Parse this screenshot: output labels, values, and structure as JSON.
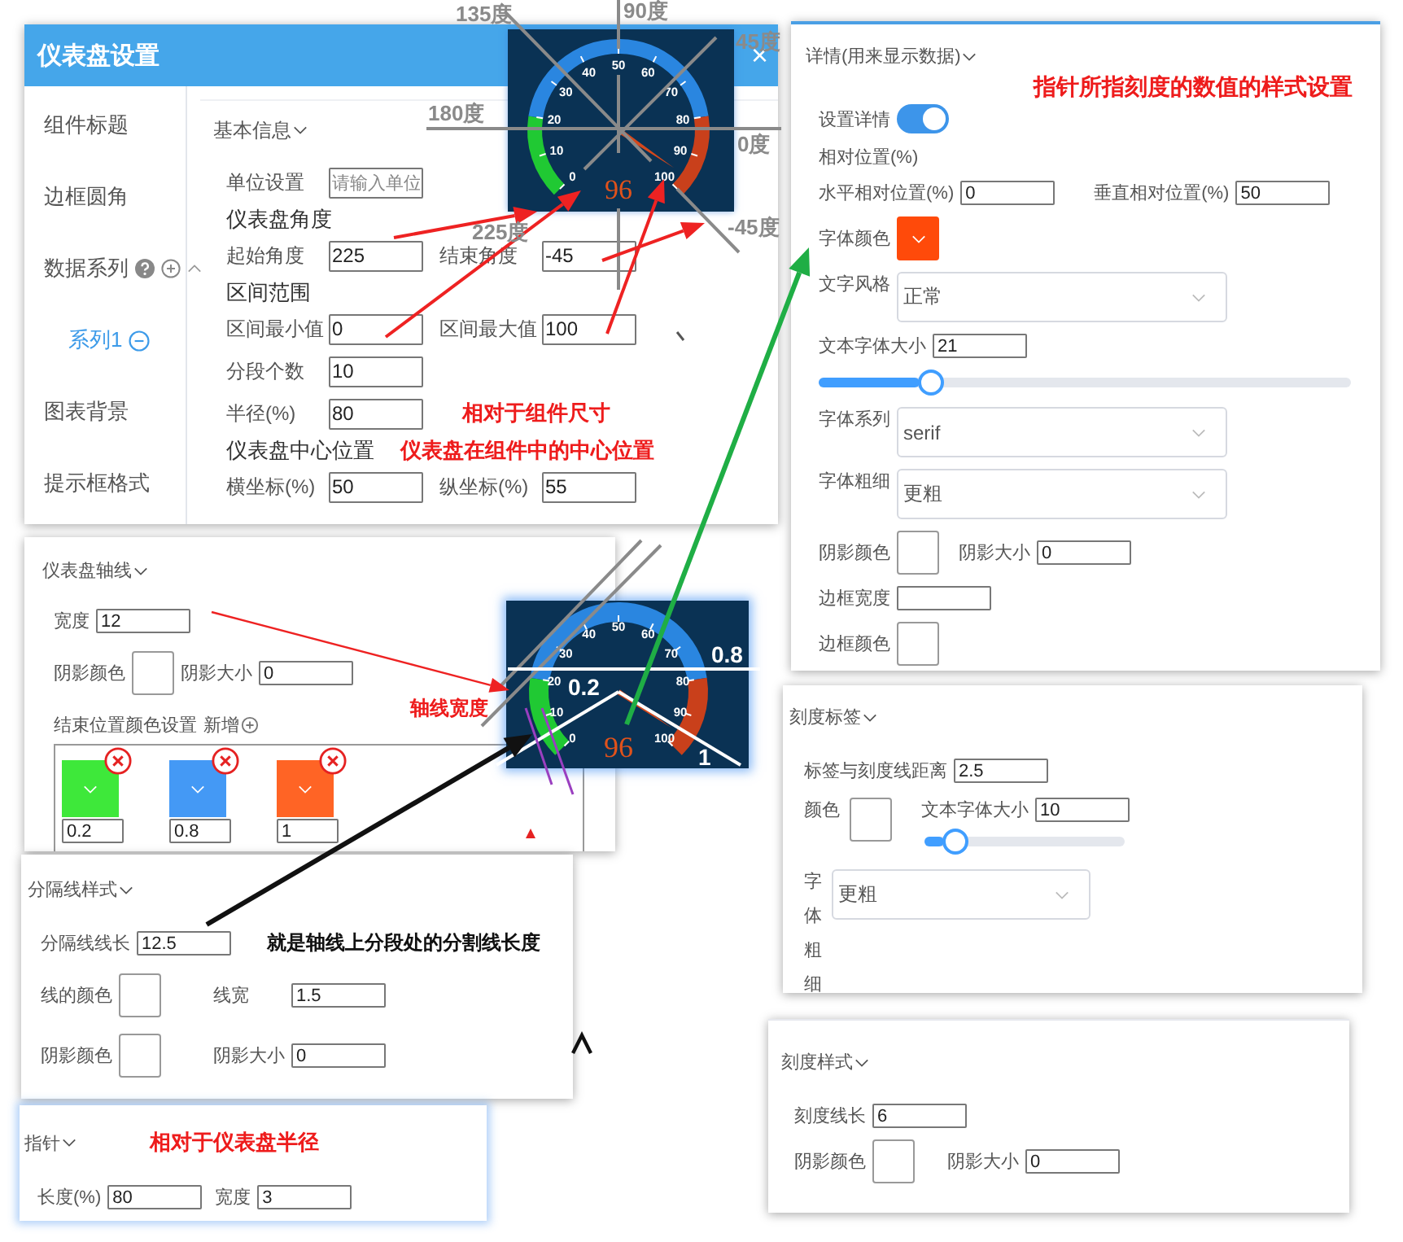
{
  "dialog": {
    "title": "仪表盘设置",
    "close": "×",
    "sidebar": [
      {
        "kind": "item",
        "label": "组件标题"
      },
      {
        "kind": "item",
        "label": "边框圆角"
      },
      {
        "kind": "group",
        "label": "数据系列",
        "expanded": true
      },
      {
        "kind": "child",
        "label": "系列1"
      },
      {
        "kind": "item",
        "label": "图表背景"
      },
      {
        "kind": "item",
        "label": "提示框格式"
      }
    ],
    "section": "基本信息",
    "rows": [
      [
        {
          "kind": "input",
          "label": "单位设置",
          "placeholder": "请输入单位"
        }
      ],
      [
        {
          "kind": "heading",
          "label": "仪表盘角度"
        }
      ],
      [
        {
          "kind": "input",
          "label": "起始角度",
          "value": "225"
        },
        {
          "kind": "input",
          "label": "结束角度",
          "value": "-45"
        }
      ],
      [
        {
          "kind": "heading",
          "label": "区间范围"
        }
      ],
      [
        {
          "kind": "input",
          "label": "区间最小值",
          "value": "0"
        },
        {
          "kind": "input",
          "label": "区间最大值",
          "value": "100"
        }
      ],
      [
        {
          "kind": "input",
          "label": "分段个数",
          "value": "10"
        }
      ],
      [
        {
          "kind": "input",
          "label": "半径(%)",
          "value": "80"
        },
        {
          "kind": "note",
          "text": "相对于组件尺寸"
        }
      ],
      [
        {
          "kind": "heading",
          "label": "仪表盘中心位置"
        },
        {
          "kind": "note",
          "text": "仪表盘在组件中的中心位置"
        }
      ],
      [
        {
          "kind": "input",
          "label": "横坐标(%)",
          "value": "50"
        },
        {
          "kind": "input",
          "label": "纵坐标(%)",
          "value": "55"
        }
      ]
    ]
  },
  "gauge_top": {
    "tick_labels": [
      "0",
      "10",
      "20",
      "30",
      "40",
      "50",
      "60",
      "70",
      "80",
      "90",
      "100"
    ],
    "value": "96"
  },
  "detail_panel": {
    "title": "详情(用来显示数据)",
    "note": "指针所指刻度的数值的样式设置",
    "rows": [
      [
        {
          "kind": "toggle",
          "label": "设置详情",
          "on": true
        }
      ],
      [
        {
          "kind": "text",
          "label": "相对位置(%)"
        }
      ],
      [
        {
          "kind": "input",
          "label": "水平相对位置(%)",
          "value": "0"
        },
        {
          "kind": "input",
          "label": "垂直相对位置(%)",
          "value": "50"
        }
      ],
      [
        {
          "kind": "swatch",
          "label": "字体颜色",
          "color": "#ff4a0a"
        }
      ],
      [
        {
          "kind": "select",
          "label": "文字风格",
          "value": "正常"
        }
      ],
      [
        {
          "kind": "input",
          "label": "文本字体大小",
          "value": "21"
        }
      ],
      [
        {
          "kind": "slider",
          "level": 0.19
        }
      ],
      [
        {
          "kind": "select",
          "label": "字体系列",
          "value": "serif"
        }
      ],
      [
        {
          "kind": "select",
          "label": "字体粗细",
          "value": "更粗"
        }
      ],
      [
        {
          "kind": "swatch",
          "label": "阴影颜色"
        },
        {
          "kind": "input",
          "label": "阴影大小",
          "value": "0"
        }
      ],
      [
        {
          "kind": "input",
          "label": "边框宽度"
        }
      ],
      [
        {
          "kind": "swatch",
          "label": "边框颜色"
        }
      ]
    ]
  },
  "axis_panel": {
    "title": "仪表盘轴线",
    "rows": [
      [
        {
          "kind": "input",
          "label": "宽度",
          "value": "12"
        }
      ],
      [
        {
          "kind": "swatch",
          "label": "阴影颜色"
        },
        {
          "kind": "input",
          "label": "阴影大小",
          "value": "0"
        }
      ],
      [
        {
          "kind": "add",
          "label": "结束位置颜色设置",
          "action": "新增"
        }
      ],
      [
        {
          "kind": "stops",
          "stops": [
            {
              "color": "#3ee83a",
              "value": "0.2"
            },
            {
              "color": "#4499f5",
              "value": "0.8"
            },
            {
              "color": "#ff6425",
              "value": "1"
            }
          ]
        }
      ]
    ]
  },
  "gauge_bottom": {
    "tick_labels": [
      "0",
      "10",
      "20",
      "30",
      "40",
      "50",
      "60",
      "70",
      "80",
      "90",
      "100"
    ],
    "value": "96"
  },
  "separator_panel": {
    "title": "分隔线样式",
    "rows": [
      [
        {
          "kind": "input",
          "label": "分隔线线长",
          "value": "12.5"
        },
        {
          "kind": "remark",
          "text": "就是轴线上分段处的分割线长度"
        }
      ],
      [
        {
          "kind": "swatch",
          "label": "线的颜色"
        },
        {
          "kind": "input",
          "label": "线宽",
          "value": "1.5"
        }
      ],
      [
        {
          "kind": "swatch",
          "label": "阴影颜色"
        },
        {
          "kind": "input",
          "label": "阴影大小",
          "value": "0"
        }
      ]
    ]
  },
  "pointer_panel": {
    "title": "指针",
    "note": "相对于仪表盘半径",
    "rows": [
      [
        {
          "kind": "input",
          "label": "长度(%)",
          "value": "80"
        },
        {
          "kind": "input",
          "label": "宽度",
          "value": "3"
        }
      ]
    ]
  },
  "tick_label_panel": {
    "title": "刻度标签",
    "rows": [
      [
        {
          "kind": "input",
          "label": "标签与刻度线距离",
          "value": "2.5"
        }
      ],
      [
        {
          "kind": "swatch",
          "label": "颜色"
        },
        {
          "kind": "group",
          "items": [
            {
              "kind": "input",
              "label": "文本字体大小",
              "value": "10"
            },
            {
              "kind": "slider",
              "level": 0.1
            }
          ]
        }
      ],
      [
        {
          "kind": "vselect",
          "label": "字体粗细",
          "value": "更粗"
        }
      ]
    ]
  },
  "tick_style_panel": {
    "title": "刻度样式",
    "rows": [
      [
        {
          "kind": "input",
          "label": "刻度线长",
          "value": "6"
        }
      ],
      [
        {
          "kind": "swatch",
          "label": "阴影颜色"
        },
        {
          "kind": "input",
          "label": "阴影大小",
          "value": "0"
        }
      ]
    ]
  },
  "annotations": {
    "angle_labels": [
      "135度",
      "90度",
      "45度",
      "180度",
      "0度",
      "225度",
      "-45度"
    ],
    "axis_marks": [
      "0.2",
      "0.8",
      "1"
    ],
    "axis_width_note": "轴线宽度"
  }
}
